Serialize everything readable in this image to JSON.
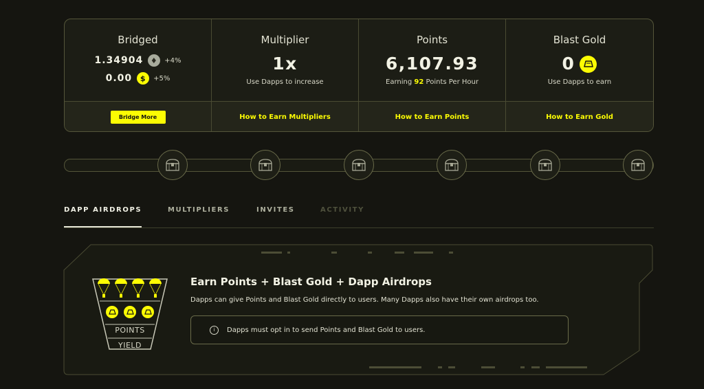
{
  "stats": {
    "bridged": {
      "title": "Bridged",
      "eth_amount": "1.34904",
      "eth_change": "+4%",
      "usdb_amount": "0.00",
      "usdb_change": "+5%",
      "button_label": "Bridge More"
    },
    "multiplier": {
      "title": "Multiplier",
      "value": "1x",
      "subtitle": "Use Dapps to increase",
      "link": "How to Earn Multipliers"
    },
    "points": {
      "title": "Points",
      "value": "6,107.93",
      "subtitle_prefix": "Earning",
      "rate": "92",
      "subtitle_suffix": "Points Per Hour",
      "link": "How to Earn Points"
    },
    "blast_gold": {
      "title": "Blast Gold",
      "value": "0",
      "subtitle": "Use Dapps to earn",
      "link": "How to Earn Gold"
    }
  },
  "tabs": [
    {
      "label": "DAPP AIRDROPS",
      "state": "active"
    },
    {
      "label": "MULTIPLIERS",
      "state": "normal"
    },
    {
      "label": "INVITES",
      "state": "normal"
    },
    {
      "label": "ACTIVITY",
      "state": "disabled"
    }
  ],
  "airdrops": {
    "heading": "Earn Points + Blast Gold + Dapp Airdrops",
    "description": "Dapps can give Points and Blast Gold directly to users. Many Dapps also have their own airdrops too.",
    "notice_icon": "i",
    "notice": "Dapps must opt in to send Points and Blast Gold to users.",
    "funnel_label_1": "POINTS",
    "funnel_label_2": "YIELD"
  },
  "colors": {
    "accent": "#fcfc03",
    "background": "#151510",
    "border": "#55563a"
  },
  "icons": {
    "eth": "ethereum-icon",
    "usdb": "usdb-icon",
    "gold": "gold-bar-icon",
    "chest": "treasure-chest-icon",
    "info": "info-icon"
  }
}
